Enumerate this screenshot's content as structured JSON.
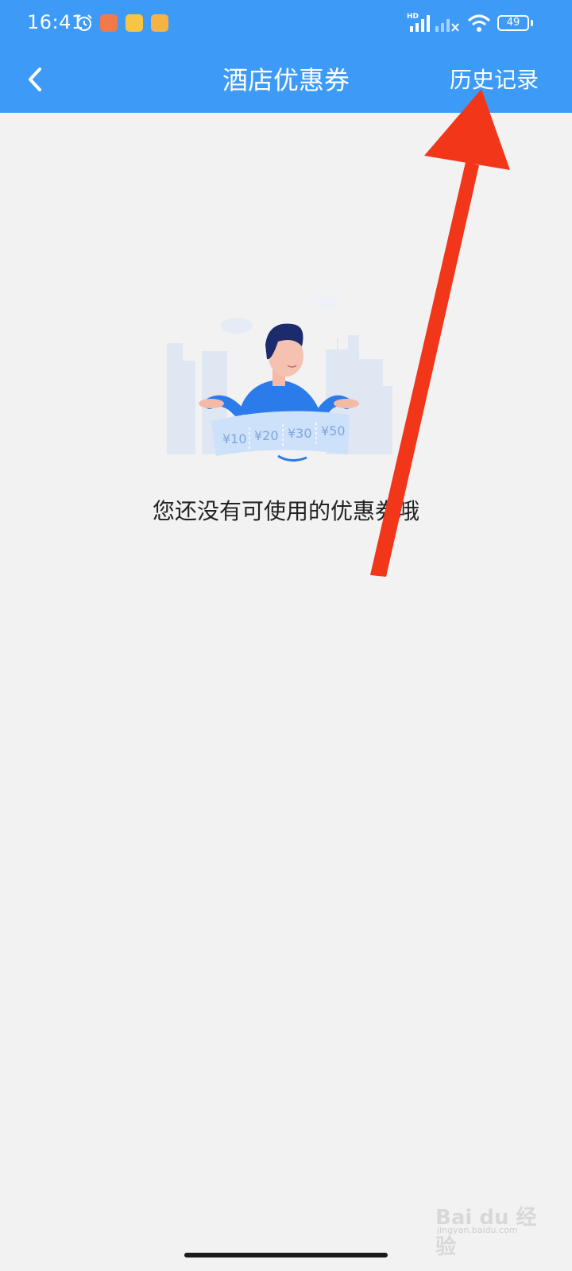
{
  "status_bar": {
    "time": "16:41",
    "network_label": "HD",
    "battery": "49",
    "icons": [
      "alarm-icon",
      "shopping-app-icon",
      "weibo-app-icon",
      "notes-app-icon",
      "signal-icon",
      "signal-no-service-icon",
      "wifi-icon",
      "battery-icon"
    ]
  },
  "nav": {
    "back_icon": "chevron-left-icon",
    "title": "酒店优惠券",
    "history_label": "历史记录"
  },
  "empty_state": {
    "message": "您还没有可使用的优惠券哦",
    "coupons": [
      "¥10",
      "¥20",
      "¥30",
      "¥50"
    ]
  },
  "overlay": {
    "annotation": "red-arrow-pointing-to-history",
    "color": "#f1361a"
  },
  "watermark": {
    "text": "Bai du 经验",
    "sub": "jingyan.baidu.com"
  },
  "colors": {
    "header": "#3d9bf7",
    "background": "#f2f2f2",
    "accent": "#2b7bea"
  }
}
